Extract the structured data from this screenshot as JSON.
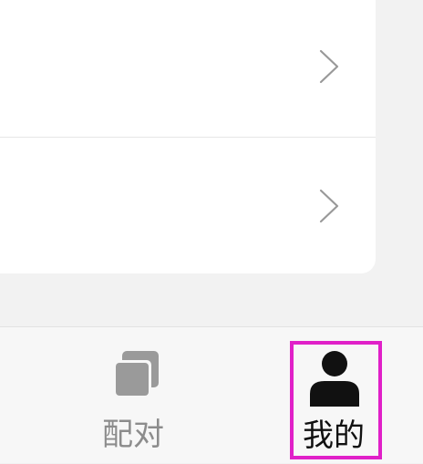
{
  "bottom_nav": {
    "tabs": [
      {
        "label": "配对",
        "icon": "copy-icon",
        "active": false,
        "color": "#8c8c8c"
      },
      {
        "label": "我的",
        "icon": "user-icon",
        "active": true,
        "color": "#111111"
      }
    ]
  },
  "colors": {
    "highlight": "#e020c8",
    "card": "#ffffff",
    "background": "#f2f2f2",
    "chevron": "#999999"
  }
}
